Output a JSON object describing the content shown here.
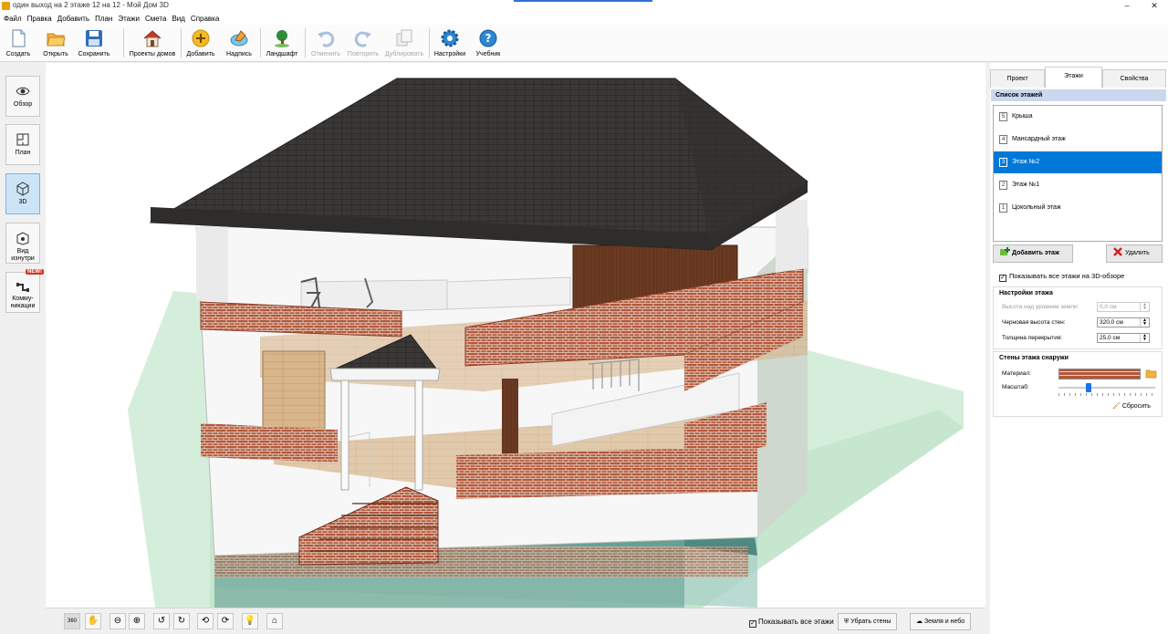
{
  "window": {
    "title": "один выход на 2 этаже 12 на 12 - Мой Дом 3D",
    "minimize": "–",
    "close": "✕"
  },
  "menu": [
    "Файл",
    "Правка",
    "Добавить",
    "План",
    "Этажи",
    "Смета",
    "Вид",
    "Справка"
  ],
  "toolbar": {
    "create": "Создать",
    "open": "Открыть",
    "save": "Сохранить",
    "house_projects": "Проекты домов",
    "add": "Добавить",
    "label": "Надпись",
    "landscape": "Ландшафт",
    "undo": "Отменить",
    "redo": "Повторить",
    "duplicate": "Дублировать",
    "settings": "Настройки",
    "tutorial": "Учебник"
  },
  "left_nav": {
    "overview": "Обзор",
    "plan": "План",
    "view3d": "3D",
    "inside_line1": "Вид",
    "inside_line2": "изнутри",
    "comm_line1": "Комму-",
    "comm_line2": "никации",
    "new_badge": "NEW!",
    "active": "3D"
  },
  "right_panel": {
    "tabs": [
      "Проект",
      "Этажи",
      "Свойства"
    ],
    "active_tab": "Этажи",
    "floor_list_title": "Список этажей",
    "floors": [
      {
        "num": "5",
        "name": "Крыша"
      },
      {
        "num": "4",
        "name": "Мансардный этаж"
      },
      {
        "num": "3",
        "name": "Этаж №2"
      },
      {
        "num": "2",
        "name": "Этаж №1"
      },
      {
        "num": "1",
        "name": "Цокольный этаж"
      }
    ],
    "selected_floor": "Этаж №2",
    "add_floor": "Добавить этаж",
    "delete": "Удалить",
    "show_all_3d": "Показывать все этажи на 3D-обзоре",
    "floor_settings": {
      "title": "Настройки этажа",
      "height_label": "Высота над уровнем земли:",
      "height_value": "0,0 см",
      "wall_label": "Черновая высота стен:",
      "wall_value": "320,0 см",
      "slab_label": "Толщина перекрытия:",
      "slab_value": "25,0 см"
    },
    "outer_walls": {
      "title": "Стены этажа снаружи",
      "material_label": "Материал:",
      "scale_label": "Масштаб:",
      "scale_value": 0.28,
      "reset": "Сбросить"
    }
  },
  "bottom_bar": {
    "rotate_label": "360",
    "show_all_floors": "Показывать все этажи",
    "remove_walls": "Убрать стены",
    "ground_sky": "Земля и небо"
  },
  "colors": {
    "accent": "#0078d7",
    "section_header": "#c9d8ee",
    "brick": "#b3583b",
    "roof": "#3a3836",
    "ground": "#4e8a82"
  }
}
